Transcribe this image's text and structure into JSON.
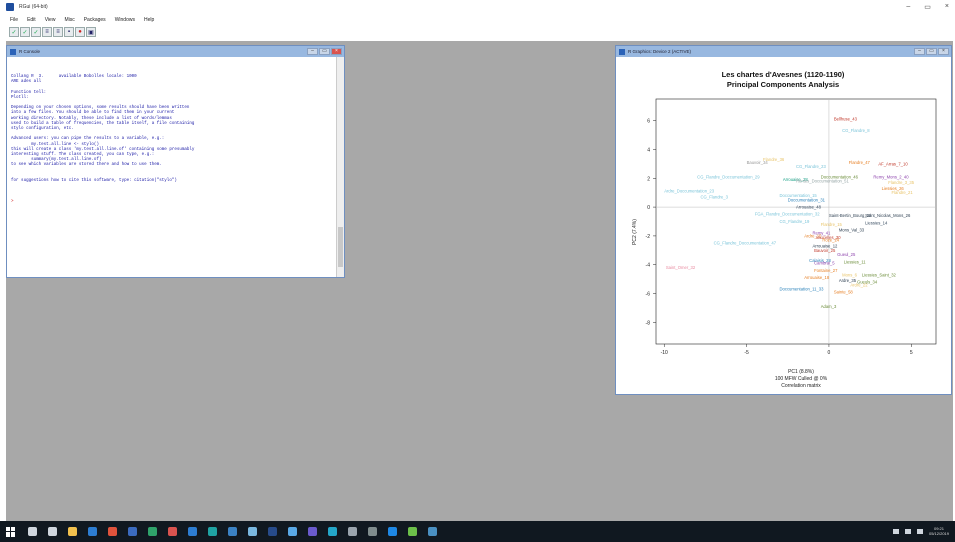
{
  "window": {
    "title": "RGui (64-bit)",
    "controls": [
      "–",
      "▭",
      "×"
    ]
  },
  "menubar": {
    "items": [
      "File",
      "Edit",
      "View",
      "Misc",
      "Packages",
      "Windows",
      "Help"
    ]
  },
  "toolbar": {
    "buttons": [
      {
        "name": "open-script",
        "glyph": "✓"
      },
      {
        "name": "load-workspace",
        "glyph": "✓"
      },
      {
        "name": "save-workspace",
        "glyph": "✓"
      },
      {
        "name": "copy",
        "glyph": "≡"
      },
      {
        "name": "paste",
        "glyph": "≡"
      },
      {
        "name": "copy-paste",
        "glyph": "▪"
      },
      {
        "name": "stop",
        "glyph": "●"
      },
      {
        "name": "print",
        "glyph": "▣"
      }
    ]
  },
  "console": {
    "title": "R Console",
    "controls": [
      "–",
      "▭",
      "×"
    ],
    "lines": [
      "Collang R  3.      available Bobolles locale: 1000",
      "ARE ades all",
      "",
      "Function tell:",
      "Plotll:",
      "",
      "Depending on your chosen options, some results should have been written",
      "into a few files. You should be able to find them in your current",
      "working directory. Notably, these include a list of words/lemmas",
      "used to build a table of frequencies, the table itself, a file containing",
      "stylo configuration, etc.",
      "",
      "Advanced users: you can pipe the results to a variable, e.g.:",
      "        my.test.all.line <- stylo()",
      "this will create a class 'my.test.all.line.of' containing some presumably",
      "interesting stuff. The class created, you can type, e.g.:",
      "        summary(my.test.all.line.of)",
      "to see which variables are stored there and how to use them.",
      "",
      "",
      "for suggestions how to cite this software, type: citation(\"stylo\")",
      "",
      "",
      ""
    ],
    "prompt": ">"
  },
  "graphics": {
    "title": "R Graphics: Device 2 (ACTIVE)",
    "controls": [
      "–",
      "▭",
      "×"
    ]
  },
  "chart_data": {
    "type": "scatter",
    "title": "Les chartes d'Avesnes (1120-1190)",
    "subtitle": "Principal Components Analysis",
    "xlabel": "PC1 (8.8%)",
    "ylabel": "PC2 (7.4%)",
    "caption_lines": [
      "100 MFW  Culled @ 0%",
      "Correlation matrix"
    ],
    "xlim": [
      -10.5,
      6.5
    ],
    "ylim": [
      -9.5,
      7.5
    ],
    "x_ticks": [
      -10,
      -5,
      0,
      5
    ],
    "y_ticks": [
      -8,
      -6,
      -4,
      -2,
      0,
      2,
      4,
      6
    ],
    "grid": false,
    "reference_lines": {
      "x": 0,
      "y": 0
    },
    "points": [
      {
        "label": "Bellhuse_43",
        "x": 0.3,
        "y": 6.0,
        "color": "#c0392b"
      },
      {
        "label": "CG_Flandre_8",
        "x": 0.8,
        "y": 5.2,
        "color": "#7ac4d9"
      },
      {
        "label": "Flandre_36",
        "x": -4.0,
        "y": 3.2,
        "color": "#e8c46a"
      },
      {
        "label": "Bauvoir_34",
        "x": -5.0,
        "y": 3.0,
        "color": "#999999"
      },
      {
        "label": "Flandre_47",
        "x": 1.2,
        "y": 3.0,
        "color": "#e67e22"
      },
      {
        "label": "AF_Arras_7_10",
        "x": 3.0,
        "y": 2.9,
        "color": "#c0392b"
      },
      {
        "label": "CG_Flandre_23",
        "x": -2.0,
        "y": 2.7,
        "color": "#7ac4d9"
      },
      {
        "label": "Doccumentation_46",
        "x": -0.5,
        "y": 2.0,
        "color": "#6c8d3a"
      },
      {
        "label": "Remy_Mons_2_40",
        "x": 2.7,
        "y": 2.0,
        "color": "#8e44ad"
      },
      {
        "label": "CG_Flandre_Doccumentation_29",
        "x": -8.0,
        "y": 2.0,
        "color": "#7ac4d9"
      },
      {
        "label": "Arrouaise_28",
        "x": -2.8,
        "y": 1.8,
        "color": "#16a085"
      },
      {
        "label": "Rentes_Doccumentation_51",
        "x": -2.0,
        "y": 1.7,
        "color": "#95a5a6"
      },
      {
        "label": "Flandre_3_35",
        "x": 3.6,
        "y": 1.6,
        "color": "#e8c46a"
      },
      {
        "label": "Ardre_Doccumentation_23",
        "x": -10.0,
        "y": 1.0,
        "color": "#7ac4d9"
      },
      {
        "label": "Doccumentation_15",
        "x": -3.0,
        "y": 0.7,
        "color": "#7ac4d9"
      },
      {
        "label": "CG_Flandre_3",
        "x": -7.8,
        "y": 0.6,
        "color": "#7ac4d9"
      },
      {
        "label": "Liessies_26",
        "x": 3.2,
        "y": 1.2,
        "color": "#e67e22"
      },
      {
        "label": "Doccumentation_31",
        "x": -2.5,
        "y": 0.4,
        "color": "#2980b9"
      },
      {
        "label": "Flandre_21",
        "x": 3.8,
        "y": 0.9,
        "color": "#e8c46a"
      },
      {
        "label": "Arrouaise_48",
        "x": -2.0,
        "y": -0.1,
        "color": "#34495e"
      },
      {
        "label": "FGA_Flandre_Doccumentation_32",
        "x": -4.5,
        "y": -0.6,
        "color": "#7ac4d9"
      },
      {
        "label": "Saint-Bertin_Bourg_22",
        "x": 0.0,
        "y": -0.7,
        "color": "#2c3e50"
      },
      {
        "label": "Saint_Nicolas_Mons_26",
        "x": 2.2,
        "y": -0.7,
        "color": "#2c3e50"
      },
      {
        "label": "CG_Flandre_19",
        "x": -3.0,
        "y": -1.1,
        "color": "#7ac4d9"
      },
      {
        "label": "Liessies_14",
        "x": 2.2,
        "y": -1.2,
        "color": "#34495e"
      },
      {
        "label": "Flandre_15",
        "x": -0.5,
        "y": -1.3,
        "color": "#e8c46a"
      },
      {
        "label": "Mons_Val_33",
        "x": 0.6,
        "y": -1.7,
        "color": "#2c3e50"
      },
      {
        "label": "Remy_41",
        "x": -1.0,
        "y": -1.9,
        "color": "#8e44ad"
      },
      {
        "label": "Ardre_15",
        "x": -1.5,
        "y": -2.1,
        "color": "#e67e22"
      },
      {
        "label": "Vaucelles_30",
        "x": -0.8,
        "y": -2.2,
        "color": "#c0392b"
      },
      {
        "label": "Roze_24",
        "x": -0.4,
        "y": -2.4,
        "color": "#e67e22"
      },
      {
        "label": "CG_Flandre_Doccumentation_47",
        "x": -7.0,
        "y": -2.6,
        "color": "#7ac4d9"
      },
      {
        "label": "Arrouaise_12",
        "x": -1.0,
        "y": -2.8,
        "color": "#2c3e50"
      },
      {
        "label": "Bauvoir_25",
        "x": -0.9,
        "y": -3.1,
        "color": "#c0392b"
      },
      {
        "label": "Gueul_25",
        "x": 0.5,
        "y": -3.4,
        "color": "#8e44ad"
      },
      {
        "label": "Calaisis_28",
        "x": -1.2,
        "y": -3.8,
        "color": "#2980b9"
      },
      {
        "label": "Liessies_11",
        "x": 0.9,
        "y": -3.9,
        "color": "#6c8d3a"
      },
      {
        "label": "Cambrai_5",
        "x": -0.9,
        "y": -4.0,
        "color": "#8e44ad"
      },
      {
        "label": "Saint_Omer_32",
        "x": -9.9,
        "y": -4.3,
        "color": "#e98aa0"
      },
      {
        "label": "Fontaine_27",
        "x": -0.9,
        "y": -4.5,
        "color": "#e67e22"
      },
      {
        "label": "Mons_6",
        "x": 0.8,
        "y": -4.8,
        "color": "#e8c46a"
      },
      {
        "label": "Liessies_Saint_32",
        "x": 2.0,
        "y": -4.8,
        "color": "#6c8d3a"
      },
      {
        "label": "Arrouaise_18",
        "x": -1.5,
        "y": -5.0,
        "color": "#e67e22"
      },
      {
        "label": "Ardre_35",
        "x": 0.6,
        "y": -5.2,
        "color": "#2c3e50"
      },
      {
        "label": "Gueuls_34",
        "x": 1.7,
        "y": -5.3,
        "color": "#6c8d3a"
      },
      {
        "label": "Ardre_22",
        "x": 1.3,
        "y": -5.5,
        "color": "#e8c46a"
      },
      {
        "label": "Doccumentation_11_33",
        "x": -3.0,
        "y": -5.8,
        "color": "#2980b9"
      },
      {
        "label": "Sainte_58",
        "x": 0.3,
        "y": -6.0,
        "color": "#e67e22"
      },
      {
        "label": "Adam_3",
        "x": -0.5,
        "y": -7.0,
        "color": "#6c8d3a"
      }
    ]
  },
  "taskbar": {
    "icons": [
      {
        "name": "search",
        "color": "#cfd6de"
      },
      {
        "name": "task-view",
        "color": "#cfd6de"
      },
      {
        "name": "file-explorer",
        "color": "#f2c14e"
      },
      {
        "name": "edge",
        "color": "#2d7dd2"
      },
      {
        "name": "chrome",
        "color": "#e0533c"
      },
      {
        "name": "rgui",
        "color": "#3b6bbf"
      },
      {
        "name": "app-green",
        "color": "#2fa36b"
      },
      {
        "name": "app-red",
        "color": "#d9534f"
      },
      {
        "name": "app-blue",
        "color": "#2d7dd2"
      },
      {
        "name": "app-teal",
        "color": "#1fa3a3"
      },
      {
        "name": "app-blue-2",
        "color": "#3b82c4"
      },
      {
        "name": "app-check",
        "color": "#7ab8e0"
      },
      {
        "name": "app-navy",
        "color": "#274b8a"
      },
      {
        "name": "app-sky",
        "color": "#5aa9e6"
      },
      {
        "name": "app-violet",
        "color": "#6a5acd"
      },
      {
        "name": "app-cyan",
        "color": "#24a7c9"
      },
      {
        "name": "app-grey",
        "color": "#9aa4ad"
      },
      {
        "name": "app-slate",
        "color": "#7f8c8d"
      },
      {
        "name": "app-azure",
        "color": "#1e88e5"
      },
      {
        "name": "app-lime",
        "color": "#6cc04a"
      },
      {
        "name": "app-steel",
        "color": "#4a90c2"
      }
    ],
    "clock_time": "09:21",
    "clock_date": "05/12/2019"
  }
}
